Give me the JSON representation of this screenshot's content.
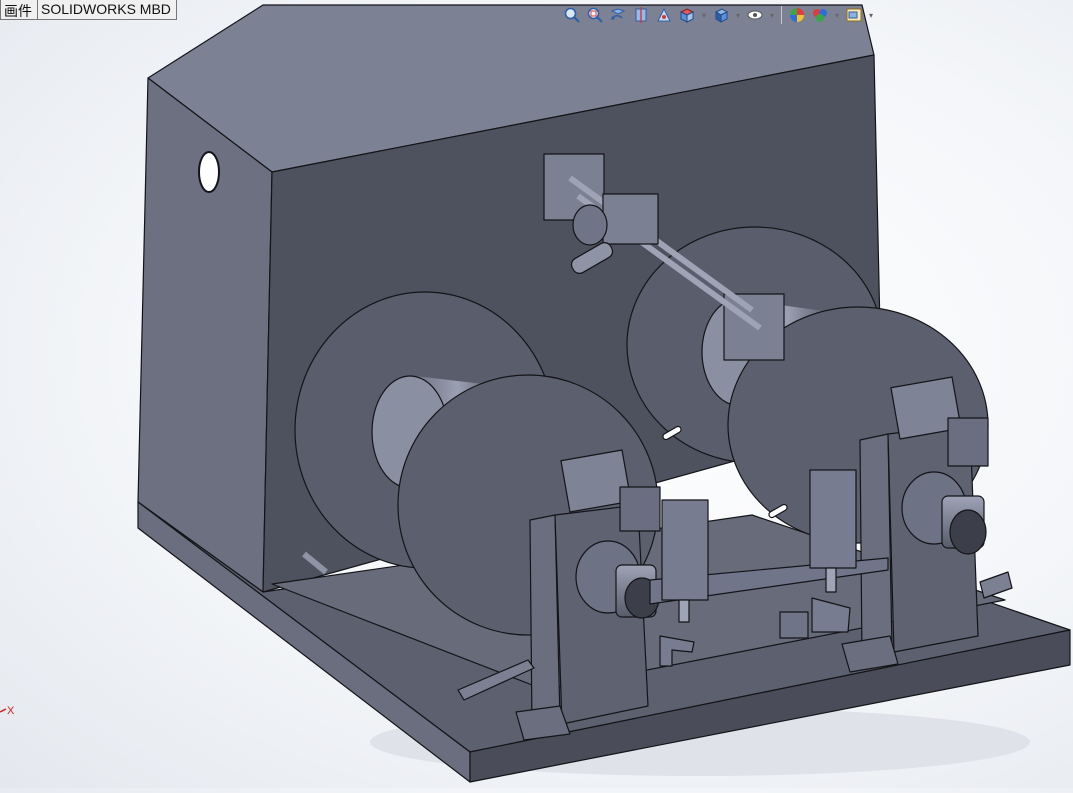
{
  "window": {
    "tabs": [
      {
        "label": "画件"
      },
      {
        "label": "SOLIDWORKS MBD"
      }
    ]
  },
  "heads_up_toolbar": {
    "tools": [
      {
        "icon": "zoom-to-fit-icon"
      },
      {
        "icon": "zoom-to-area-icon"
      },
      {
        "icon": "previous-view-icon"
      },
      {
        "icon": "section-view-icon"
      },
      {
        "icon": "dynamic-annotation-icon"
      },
      {
        "icon": "view-orientation-icon"
      },
      {
        "icon": "display-style-icon"
      },
      {
        "icon": "hide-show-items-icon"
      },
      {
        "icon": "edit-appearance-icon"
      },
      {
        "icon": "apply-scene-icon"
      },
      {
        "icon": "view-settings-icon"
      }
    ]
  },
  "triad": {
    "x_label": "X",
    "x_color": "#cc2222"
  },
  "model": {
    "body_color": "#5d6170",
    "frame_color": "#5a5e6e",
    "highlight_color": "#8a90a6",
    "edge_color": "#141418"
  }
}
